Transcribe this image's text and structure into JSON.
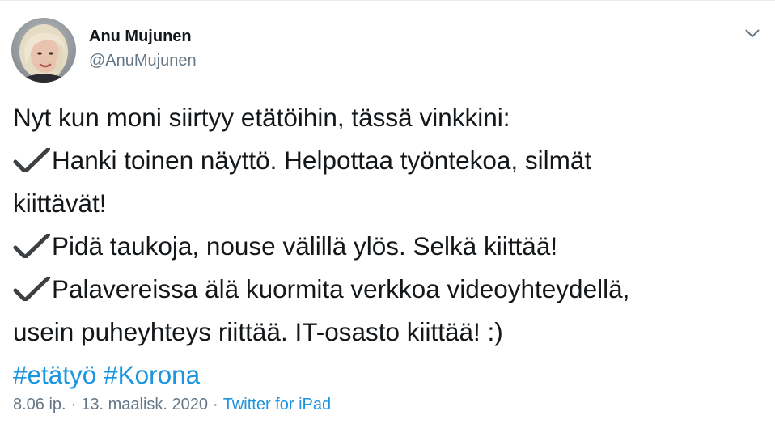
{
  "tweet": {
    "author": {
      "display_name": "Anu Mujunen",
      "handle": "@AnuMujunen",
      "avatar_icon": "profile-photo"
    },
    "caret_icon": "chevron-down-icon",
    "lines": {
      "intro": "Nyt kun moni siirtyy etätöihin, tässä vinkkini:",
      "tip1_line1": "Hanki toinen näyttö. Helpottaa työntekoa, silmät",
      "tip1_line2": "kiittävät!",
      "tip2": "Pidä taukoja, nouse välillä ylös. Selkä kiittää!",
      "tip3_line1": "Palavereissa älä kuormita verkkoa videoyhteydellä,",
      "tip3_line2": "usein puheyhteys riittää. IT-osasto kiittää! :)"
    },
    "check_icon": "heavy-check-mark-icon",
    "hashtags": [
      "#etätyö",
      "#Korona"
    ],
    "meta": {
      "time": "8.06 ip.",
      "separator": "·",
      "date": "13. maalisk. 2020",
      "source": "Twitter for iPad"
    },
    "colors": {
      "text": "#14171a",
      "secondary": "#657786",
      "link": "#1b95e0",
      "check": "#3c4043"
    }
  }
}
